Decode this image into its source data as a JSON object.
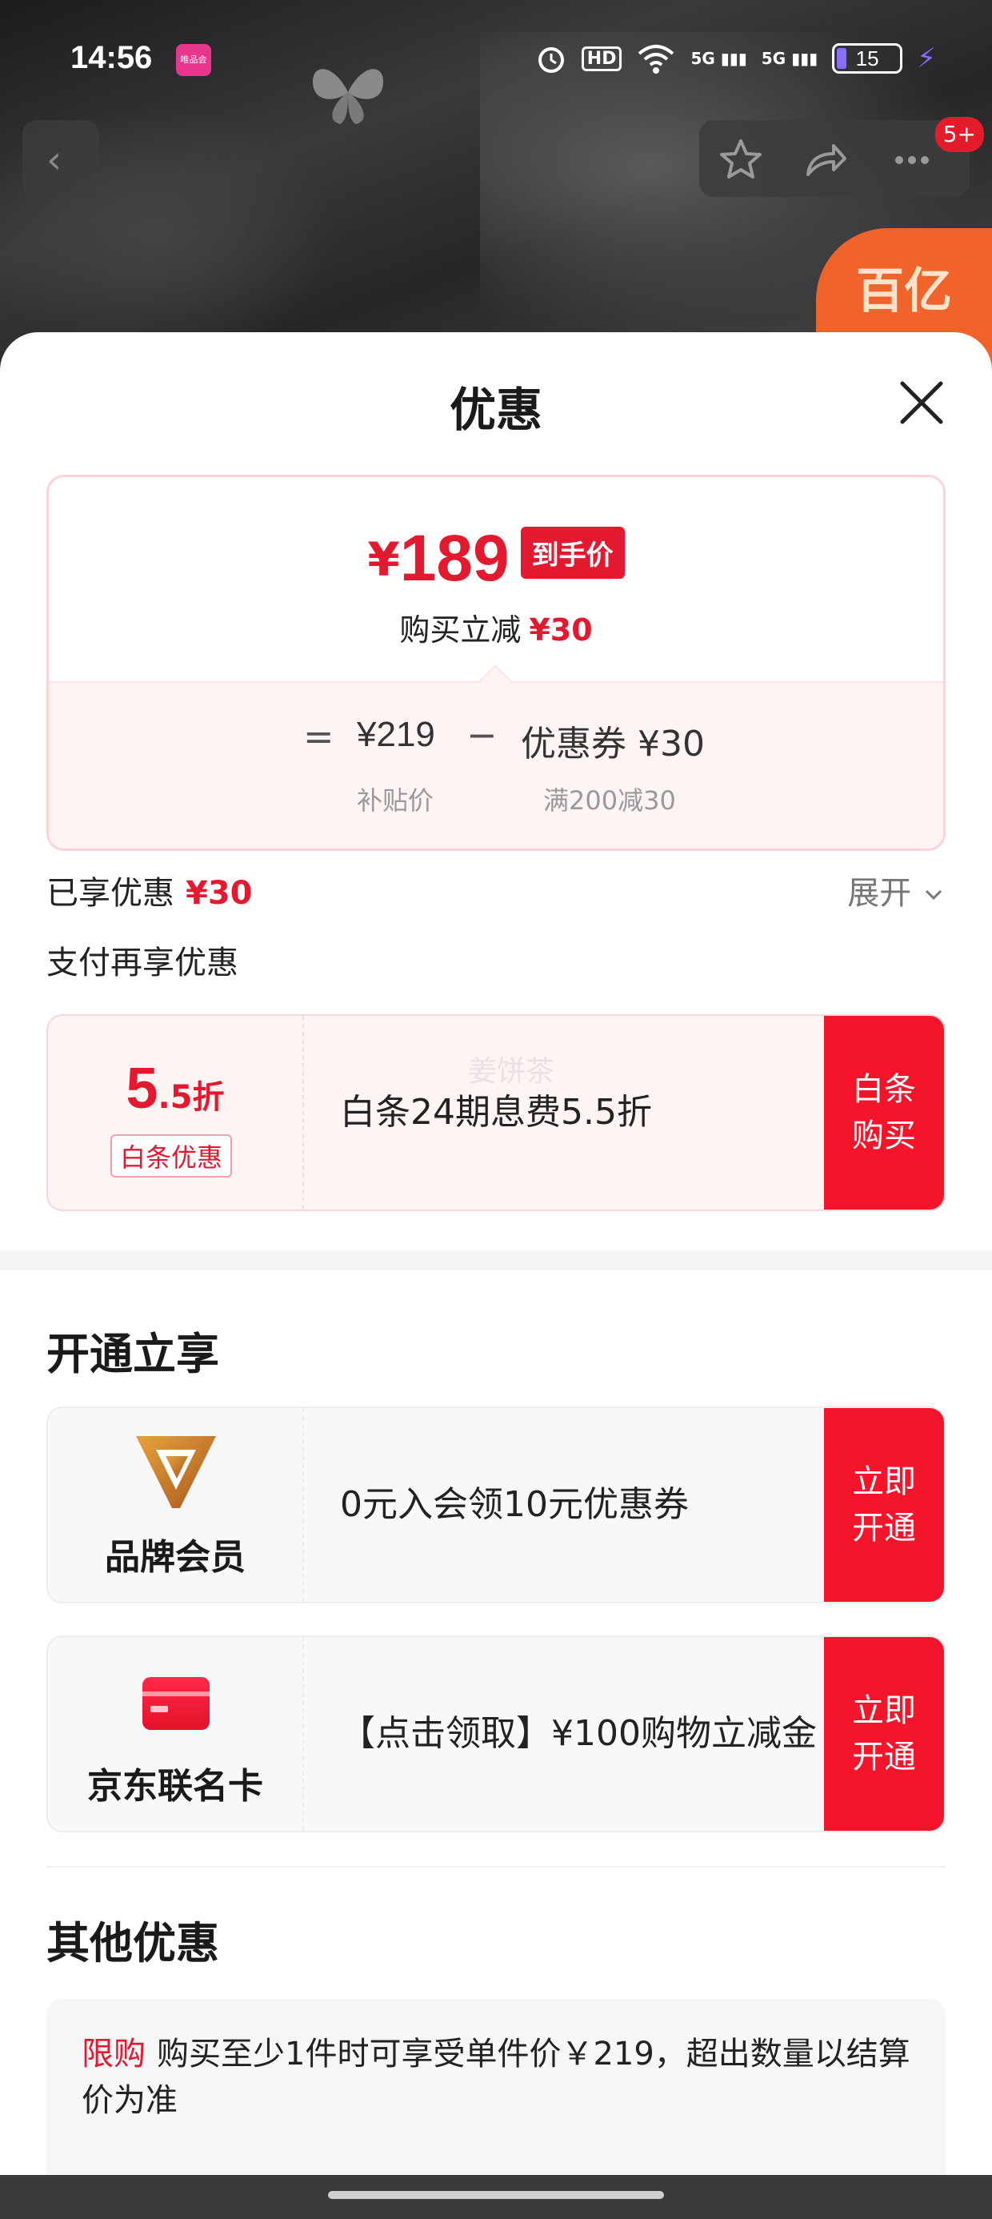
{
  "status_bar": {
    "time": "14:56",
    "app_badge": "唯品会",
    "battery": "15",
    "signal_1": "5G",
    "signal_2": "5G",
    "hd_label": "HD"
  },
  "product_header": {
    "subsidy_text": "百亿补贴",
    "badge_count": "5+"
  },
  "sheet": {
    "title": "优惠",
    "price_card": {
      "currency": "¥",
      "final_price": "189",
      "final_tag": "到手价",
      "instant_reduce_label": "购买立减",
      "instant_reduce_value": "¥30",
      "equals": "=",
      "subsidy_price": "¥219",
      "minus": "−",
      "coupon_value": "优惠券 ¥30",
      "subsidy_price_label": "补贴价",
      "coupon_rule": "满200减30"
    },
    "enjoyed_label": "已享优惠",
    "enjoyed_value": "¥30",
    "expand_label": "展开",
    "pay_again_label": "支付再享优惠",
    "baitiao_offer": {
      "discount_main": "5",
      "discount_suffix": ".5折",
      "tag": "白条优惠",
      "watermark": "姜饼茶",
      "desc": "白条24期息费5.5折",
      "action": "白条\n购买"
    },
    "open_section_title": "开通立享",
    "brand_offer": {
      "name": "品牌会员",
      "desc": "0元入会领10元优惠券",
      "action": "立即\n开通"
    },
    "card_offer": {
      "name": "京东联名卡",
      "desc": "【点击领取】¥100购物立减金",
      "action": "立即\n开通"
    },
    "other_section_title": "其他优惠",
    "limit_tag": "限购",
    "limit_text": "购买至少1件时可享受单件价￥219，超出数量以结算价为准"
  },
  "colors": {
    "accent_red": "#e3192f",
    "action_red": "#f5152b",
    "subsidy_orange": "#f0632a"
  }
}
